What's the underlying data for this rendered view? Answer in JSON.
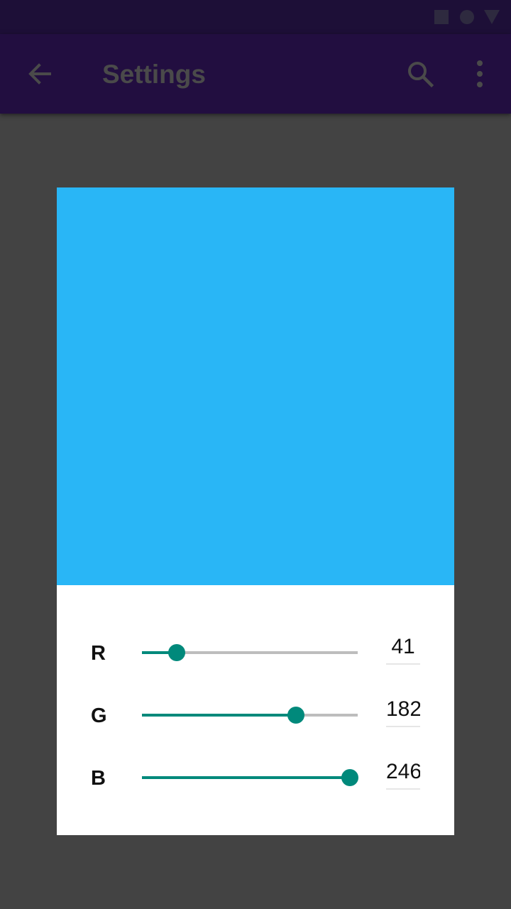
{
  "app_bar": {
    "title": "Settings",
    "bg_color": "#220e40",
    "icons": [
      "arrow-back-icon",
      "search-icon",
      "more-vert-icon"
    ]
  },
  "status_bar": {
    "icons": [
      "square-icon",
      "circle-icon",
      "triangle-icon"
    ]
  },
  "preview": {
    "color": "#29b6f6"
  },
  "channels": [
    {
      "label": "R",
      "value": "41",
      "fraction": 0.1608
    },
    {
      "label": "G",
      "value": "182",
      "fraction": 0.7137
    },
    {
      "label": "B",
      "value": "246",
      "fraction": 0.9647
    }
  ],
  "accent_color": "#00897b"
}
